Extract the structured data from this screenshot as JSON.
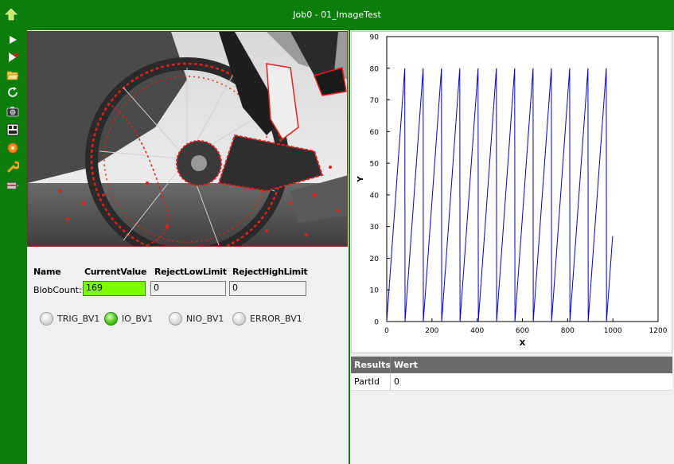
{
  "window": {
    "title": "Job0 - 01_ImageTest"
  },
  "toolbar": {
    "icons": [
      "up-arrow-icon",
      "play-icon",
      "play-record-icon",
      "open-folder-icon",
      "refresh-icon",
      "camera-icon",
      "display-icon",
      "settings-gear-icon",
      "wrench-icon",
      "toolbox-icon"
    ]
  },
  "measurements": {
    "headers": {
      "name": "Name",
      "current": "CurrentValue",
      "reject_low": "RejectLowLimit",
      "reject_high": "RejectHighLimit"
    },
    "rows": [
      {
        "name": "BlobCount:",
        "current": "169",
        "reject_low": "0",
        "reject_high": "0"
      }
    ],
    "current_ok_color": "#7cfc00"
  },
  "indicators": [
    {
      "label": "TRIG_BV1",
      "on": false
    },
    {
      "label": "IO_BV1",
      "on": true
    },
    {
      "label": "NIO_BV1",
      "on": false
    },
    {
      "label": "ERROR_BV1",
      "on": false
    }
  ],
  "chart_data": {
    "type": "line",
    "xlabel": "X",
    "ylabel": "Y",
    "xlim": [
      0,
      1200
    ],
    "ylim": [
      0,
      90
    ],
    "xticks": [
      0,
      200,
      400,
      600,
      800,
      1000,
      1200
    ],
    "yticks": [
      0,
      10,
      20,
      30,
      40,
      50,
      60,
      70,
      80,
      90
    ],
    "line_color": "#0000cc",
    "series": [
      {
        "x": [
          0,
          80,
          81,
          161,
          162,
          242,
          243,
          323,
          324,
          404,
          405,
          485,
          486,
          566,
          567,
          647,
          648,
          728,
          729,
          809,
          810,
          890,
          891,
          971,
          972,
          999
        ],
        "y": [
          0,
          80,
          0,
          80,
          0,
          80,
          0,
          80,
          0,
          80,
          0,
          80,
          0,
          80,
          0,
          80,
          0,
          80,
          0,
          80,
          0,
          80,
          0,
          80,
          0,
          27
        ]
      }
    ]
  },
  "results": {
    "headers": [
      "Results",
      "Wert"
    ],
    "rows": [
      [
        "PartId",
        "0"
      ]
    ]
  }
}
